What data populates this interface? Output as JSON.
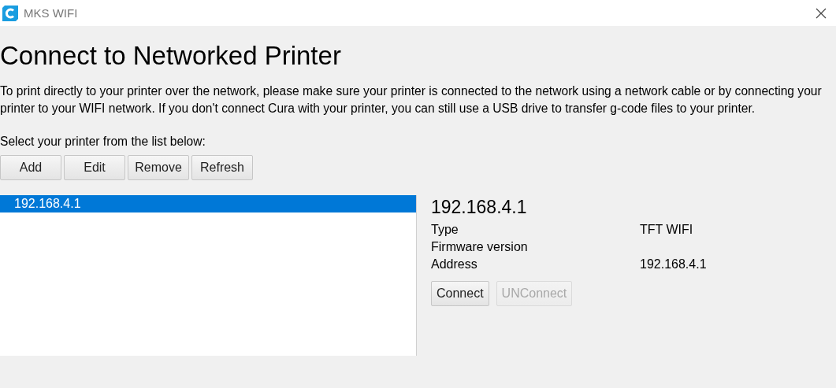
{
  "window": {
    "title": "MKS WIFI"
  },
  "heading": "Connect to Networked Printer",
  "description": "To print directly to your printer over the network, please make sure your printer is connected to the network using a network cable or by connecting your printer to your WIFI network. If you don't connect Cura with your printer, you can still use a USB drive to transfer g-code files to your printer.",
  "list_label": "Select your printer from the list below:",
  "toolbar": [
    {
      "label": "Add"
    },
    {
      "label": "Edit"
    },
    {
      "label": "Remove"
    },
    {
      "label": "Refresh"
    }
  ],
  "printers": [
    {
      "name": "192.168.4.1",
      "selected": true
    }
  ],
  "details": {
    "title": "192.168.4.1",
    "rows": [
      {
        "label": "Type",
        "value": "TFT WIFI"
      },
      {
        "label": "Firmware version"
      },
      {
        "label": "Address",
        "value": "192.168.4.1"
      }
    ],
    "buttons": [
      {
        "label": "Connect",
        "disabled": false
      },
      {
        "label": "UNConnect",
        "disabled": true
      }
    ]
  }
}
